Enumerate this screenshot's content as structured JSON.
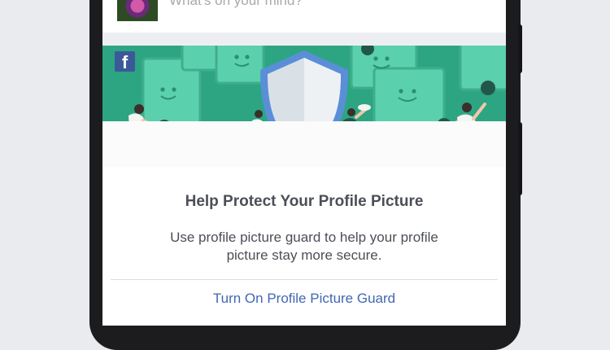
{
  "composer": {
    "placeholder": "What's on your mind?"
  },
  "card": {
    "brand_icon": "facebook-f-icon",
    "illustration": "shield-with-people-and-frames",
    "title": "Help Protect Your Profile Picture",
    "description": "Use profile picture guard to help your profile picture stay more secure.",
    "cta_label": "Turn On Profile Picture Guard"
  },
  "colors": {
    "hero_bg": "#2da583",
    "frame": "#5bd0ad",
    "shield_outer": "#5a8fd8",
    "cta": "#4267b2",
    "brand": "#3b5998"
  }
}
